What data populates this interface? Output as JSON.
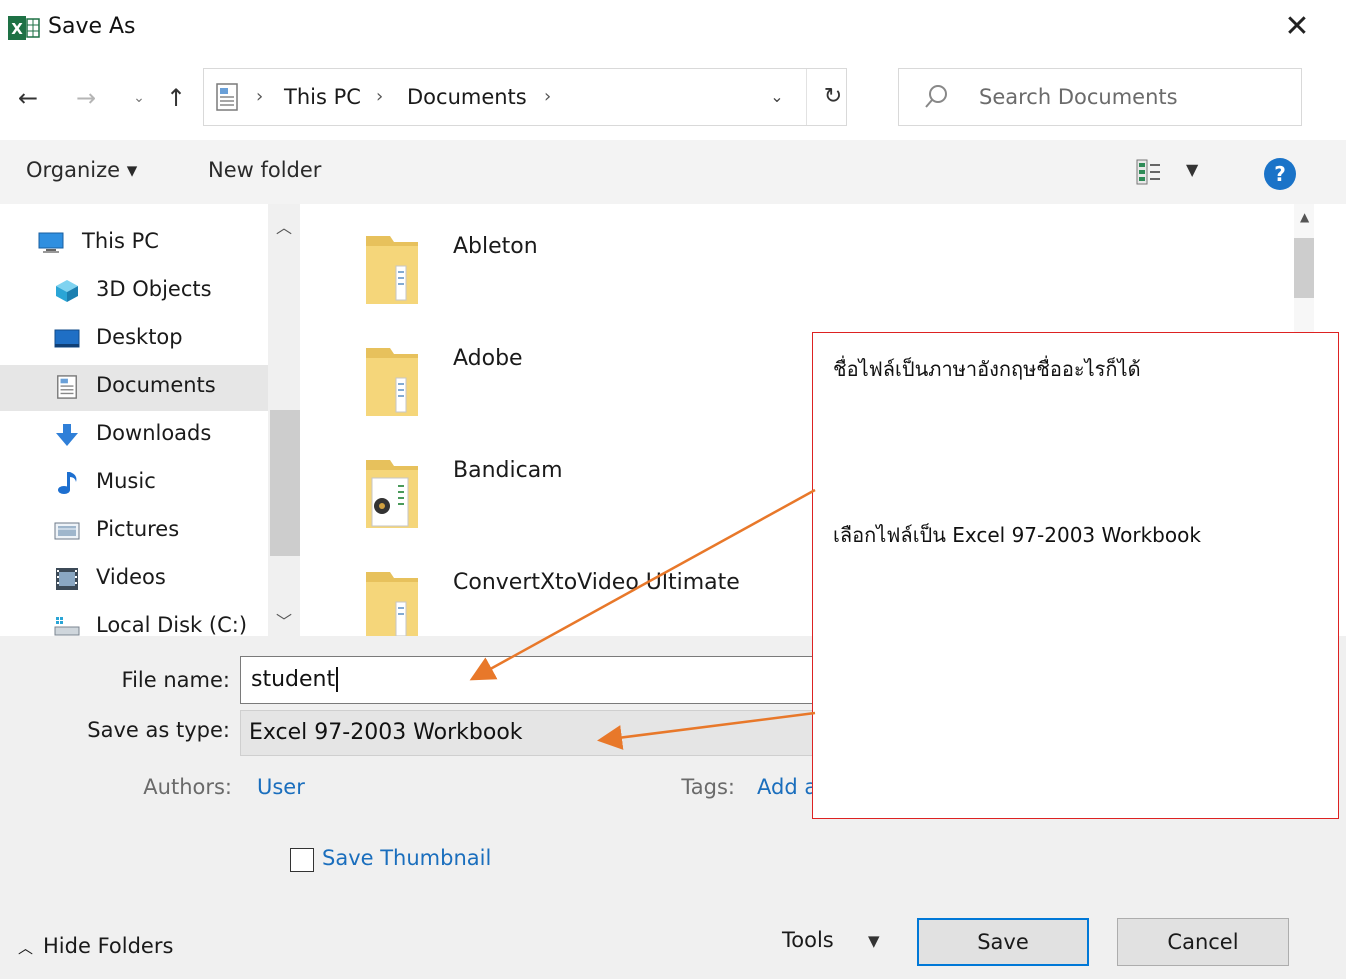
{
  "window": {
    "title": "Save As",
    "app_icon": "excel-icon"
  },
  "nav": {
    "back_icon": "arrow-left-icon",
    "forward_icon": "arrow-right-icon",
    "recent_icon": "chevron-down-icon",
    "up_icon": "arrow-up-icon"
  },
  "address": {
    "segments": [
      "This PC",
      "Documents"
    ],
    "separator": "›"
  },
  "search": {
    "placeholder": "Search Documents"
  },
  "toolbar": {
    "organize_label": "Organize ▾",
    "new_folder_label": "New folder",
    "help_label": "?"
  },
  "sidebar": {
    "items": [
      {
        "label": "This PC",
        "icon": "computer-icon"
      },
      {
        "label": "3D Objects",
        "icon": "cube-icon"
      },
      {
        "label": "Desktop",
        "icon": "desktop-icon"
      },
      {
        "label": "Documents",
        "icon": "document-icon",
        "selected": true
      },
      {
        "label": "Downloads",
        "icon": "download-icon"
      },
      {
        "label": "Music",
        "icon": "music-icon"
      },
      {
        "label": "Pictures",
        "icon": "picture-icon"
      },
      {
        "label": "Videos",
        "icon": "video-icon"
      },
      {
        "label": "Local Disk (C:)",
        "icon": "disk-icon"
      }
    ]
  },
  "files": {
    "items": [
      {
        "name": "Ableton",
        "icon": "folder-icon"
      },
      {
        "name": "Adobe",
        "icon": "folder-icon"
      },
      {
        "name": "Bandicam",
        "icon": "folder-icon"
      },
      {
        "name": "ConvertXtoVideo Ultimate",
        "icon": "folder-icon"
      }
    ]
  },
  "form": {
    "file_name_label": "File name:",
    "file_name_value": "student",
    "save_type_label": "Save as type:",
    "save_type_value": "Excel 97-2003 Workbook",
    "authors_label": "Authors:",
    "authors_value": "User",
    "tags_label": "Tags:",
    "tags_value": "Add a tag",
    "save_thumbnail_label": "Save Thumbnail",
    "save_thumbnail_checked": false
  },
  "footer": {
    "hide_folders_label": "Hide Folders",
    "tools_label": "Tools",
    "save_label": "Save",
    "cancel_label": "Cancel"
  },
  "annotation": {
    "line1": "ชื่อไฟล์เป็นภาษาอังกฤษชื่ออะไรก็ได้",
    "line2": "เลือกไฟล์เป็น Excel 97-2003 Workbook",
    "border_color": "#dd2222",
    "arrow_color": "#e8782a"
  },
  "colors": {
    "accent": "#0078d7",
    "link": "#1a6ebd",
    "excel_green": "#1e7145",
    "folder_yellow": "#f5d67a"
  }
}
